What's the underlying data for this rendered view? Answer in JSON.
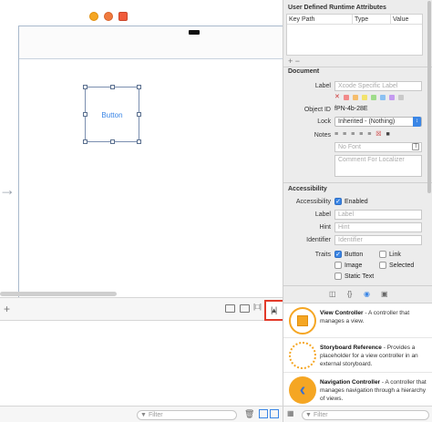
{
  "canvas": {
    "button_label": "Button"
  },
  "inspector": {
    "udra": {
      "title": "User Defined Runtime Attributes",
      "columns": [
        "Key Path",
        "Type",
        "Value"
      ],
      "add_symbol": "+ −"
    },
    "document": {
      "title": "Document",
      "label_label": "Label",
      "label_placeholder": "Xcode Specific Label",
      "swatch_colors": [
        "#f28a8a",
        "#f5bd6c",
        "#f2e36c",
        "#9fdc8a",
        "#8cc1f2",
        "#c49af0",
        "#c9c9c9"
      ],
      "object_id_label": "Object ID",
      "object_id_value": "fPN-4b-28E",
      "lock_label": "Lock",
      "lock_value": "Inherited - (Nothing)",
      "notes_label": "Notes",
      "no_font_placeholder": "No Font",
      "comment_placeholder": "Comment For Localizer"
    },
    "accessibility": {
      "title": "Accessibility",
      "accessibility_label": "Accessibility",
      "enabled_label": "Enabled",
      "label_label": "Label",
      "label_placeholder": "Label",
      "hint_label": "Hint",
      "hint_placeholder": "Hint",
      "identifier_label": "Identifier",
      "identifier_placeholder": "Identifier",
      "traits_label": "Traits",
      "traits": [
        {
          "label": "Button",
          "checked": true
        },
        {
          "label": "Link",
          "checked": false
        },
        {
          "label": "Image",
          "checked": false
        },
        {
          "label": "Selected",
          "checked": false
        },
        {
          "label": "Static Text",
          "checked": false
        }
      ]
    }
  },
  "library": {
    "items": [
      {
        "title": "View Controller",
        "desc": " - A controller that manages a view.",
        "color": "#f5a623"
      },
      {
        "title": "Storyboard Reference",
        "desc": " - Provides a placeholder for a view controller in an external storyboard.",
        "color": "#f5a623"
      },
      {
        "title": "Navigation Controller",
        "desc": " - A controller that manages navigation through a hierarchy of views.",
        "color": "#f5a623"
      }
    ],
    "filter_placeholder": "Filter"
  },
  "debug": {
    "filter_placeholder": "Filter"
  }
}
